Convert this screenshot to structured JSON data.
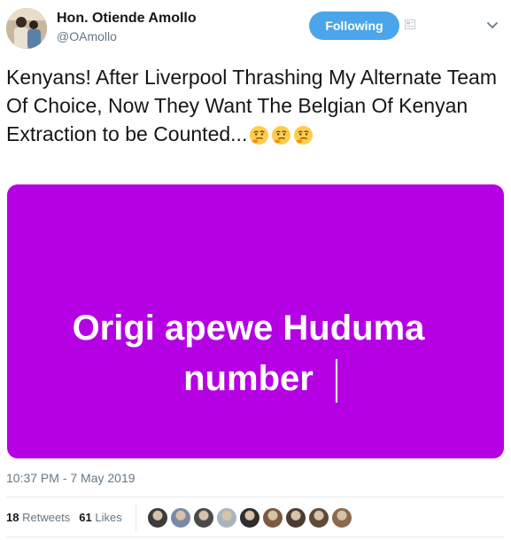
{
  "author": {
    "display_name": "Hon. Otiende Amollo",
    "handle": "@OAmollo"
  },
  "follow_button": {
    "label": "Following"
  },
  "icons": {
    "caret": "chevron-down-icon",
    "badge": "card-icon",
    "emoji": "thinking-face-icon"
  },
  "tweet": {
    "text": "Kenyans! After Liverpool Thrashing My Alternate Team Of Choice, Now They Want The Belgian Of Kenyan Extraction to be Counted...",
    "emoji_count": 3
  },
  "media": {
    "line1": "Origi apewe Huduma",
    "line2": "number",
    "background": "#b500e4"
  },
  "timestamp": "10:37 PM - 7 May 2019",
  "stats": {
    "retweets_count": "18",
    "retweets_label": "Retweets",
    "likes_count": "61",
    "likes_label": "Likes"
  },
  "likers": [
    "#3b3b3b",
    "#7a8aa6",
    "#4a4a4a",
    "#aab4be",
    "#2e2e2e",
    "#7a5a44",
    "#4c3b34",
    "#5c4a3a",
    "#8a6a50"
  ],
  "colors": {
    "follow_button": "#4ba5ea",
    "text": "#14171a",
    "secondary_text": "#657786",
    "media_background": "#b500e4"
  }
}
